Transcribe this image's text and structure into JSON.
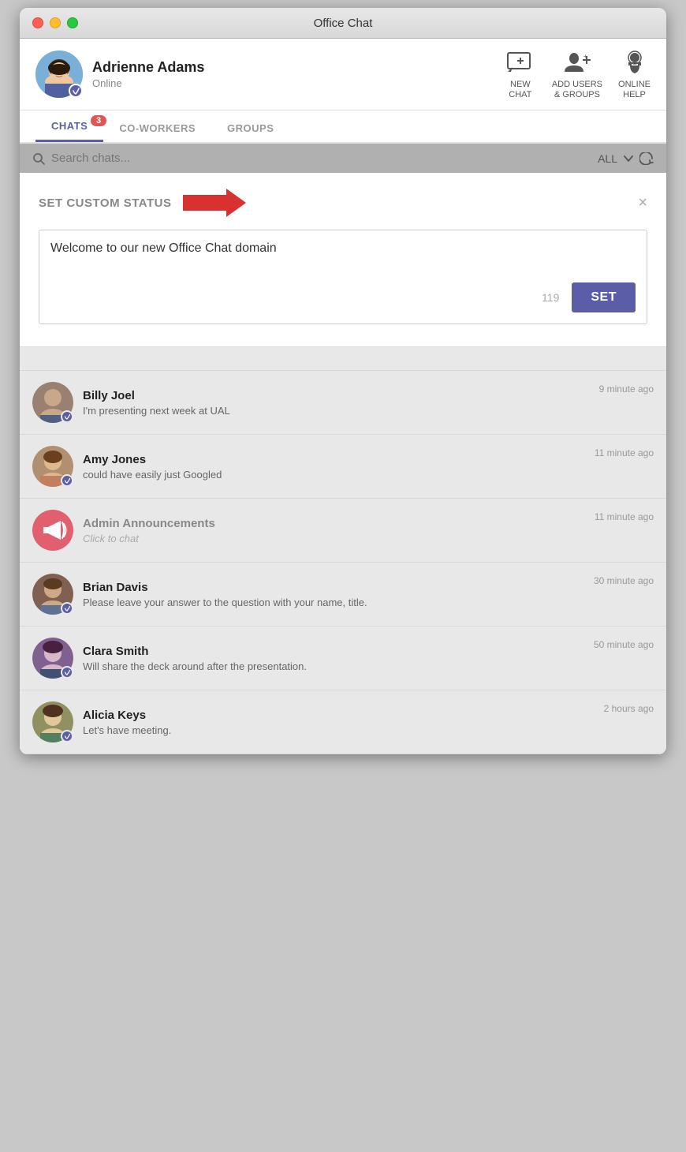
{
  "window": {
    "title": "Office Chat"
  },
  "header": {
    "user": {
      "name": "Adrienne Adams",
      "status": "Online"
    },
    "actions": [
      {
        "label": "NEW\nCHAT",
        "id": "new-chat"
      },
      {
        "label": "ADD USERS\n& GROUPS",
        "id": "add-users"
      },
      {
        "label": "ONLINE\nHELP",
        "id": "online-help"
      }
    ]
  },
  "tabs": [
    {
      "label": "CHATS",
      "active": true,
      "badge": "3"
    },
    {
      "label": "CO-WORKERS",
      "active": false,
      "badge": null
    },
    {
      "label": "GROUPS",
      "active": false,
      "badge": null
    }
  ],
  "search": {
    "placeholder": "Search chats...",
    "filter": "ALL"
  },
  "custom_status_modal": {
    "title": "SET CUSTOM STATUS",
    "text": "Welcome to our new Office Chat domain",
    "char_count": "119",
    "set_button": "SET",
    "close": "×"
  },
  "chats": [
    {
      "id": "billy-joel",
      "name": "Billy Joel",
      "preview": "I'm presenting next week at UAL",
      "time": "9 minute ago",
      "unread": false,
      "avatar_color": "#b09070"
    },
    {
      "id": "amy-jones",
      "name": "Amy Jones",
      "preview": "could have easily just Googled",
      "time": "11 minute ago",
      "unread": true,
      "avatar_color": "#c09060"
    },
    {
      "id": "admin-announcements",
      "name": "Admin Announcements",
      "preview": "Click to chat",
      "time": "11 minute ago",
      "unread": true,
      "avatar_color": "#e06070",
      "is_group": true
    },
    {
      "id": "brian-davis",
      "name": "Brian Davis",
      "preview": "Please leave your answer to the question with your name, title.",
      "time": "30 minute ago",
      "unread": false,
      "avatar_color": "#907860"
    },
    {
      "id": "clara-smith",
      "name": "Clara Smith",
      "preview": "Will share the deck around after the presentation.",
      "time": "50 minute ago",
      "unread": true,
      "avatar_color": "#a07890"
    },
    {
      "id": "alicia-keys",
      "name": "Alicia Keys",
      "preview": "Let's have meeting.",
      "time": "2 hours ago",
      "unread": true,
      "avatar_color": "#b09870"
    }
  ]
}
